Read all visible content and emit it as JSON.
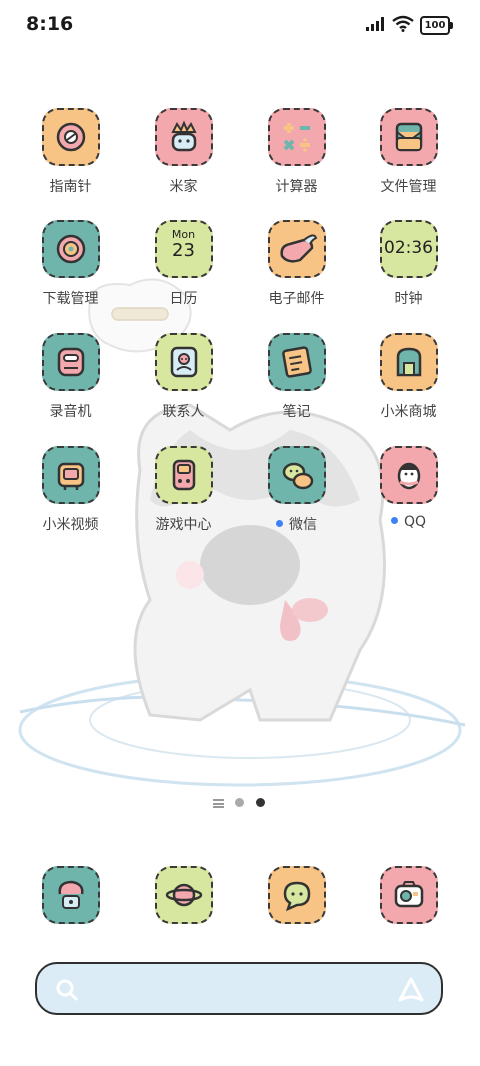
{
  "status_bar": {
    "time": "8:16",
    "battery": "100"
  },
  "apps": [
    {
      "label": "指南针",
      "icon": "compass-icon",
      "color": "#f7c486"
    },
    {
      "label": "米家",
      "icon": "mihome-icon",
      "color": "#f3a8ae"
    },
    {
      "label": "计算器",
      "icon": "calculator-icon",
      "color": "#f3a8ae"
    },
    {
      "label": "文件管理",
      "icon": "file-manager-icon",
      "color": "#f3a8ae"
    },
    {
      "label": "下载管理",
      "icon": "download-icon",
      "color": "#6fb5ac"
    },
    {
      "label": "日历",
      "icon": "calendar-icon",
      "color": "#d8e79f",
      "month": "Mon",
      "day": "23"
    },
    {
      "label": "电子邮件",
      "icon": "email-icon",
      "color": "#f7c486"
    },
    {
      "label": "时钟",
      "icon": "clock-icon",
      "color": "#d8e79f",
      "clock_text": "02:36"
    },
    {
      "label": "录音机",
      "icon": "recorder-icon",
      "color": "#6fb5ac"
    },
    {
      "label": "联系人",
      "icon": "contacts-icon",
      "color": "#d8e79f"
    },
    {
      "label": "笔记",
      "icon": "notes-icon",
      "color": "#6fb5ac"
    },
    {
      "label": "小米商城",
      "icon": "mi-store-icon",
      "color": "#f7c486"
    },
    {
      "label": "小米视频",
      "icon": "mi-video-icon",
      "color": "#6fb5ac"
    },
    {
      "label": "游戏中心",
      "icon": "game-center-icon",
      "color": "#d8e79f"
    },
    {
      "label": "微信",
      "icon": "wechat-icon",
      "color": "#6fb5ac",
      "notification_dot": true
    },
    {
      "label": "QQ",
      "icon": "qq-icon",
      "color": "#f3a8ae",
      "notification_dot": true
    }
  ],
  "pager": {
    "pages": 2,
    "current": 2
  },
  "dock": [
    {
      "icon": "phone-icon",
      "color": "#6fb5ac"
    },
    {
      "icon": "browser-icon",
      "color": "#d8e79f"
    },
    {
      "icon": "messages-icon",
      "color": "#f7c486"
    },
    {
      "icon": "camera-icon",
      "color": "#f3a8ae"
    }
  ],
  "search_bar": {
    "icon": "search-icon",
    "assistant_icon": "assistant-icon"
  }
}
